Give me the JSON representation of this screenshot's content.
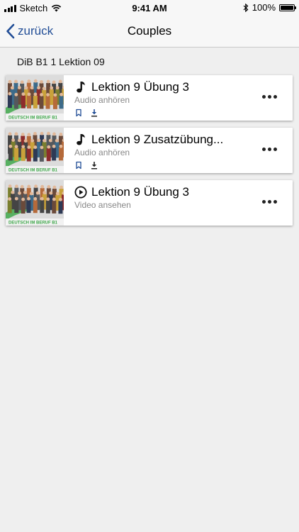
{
  "status_bar": {
    "carrier": "Sketch",
    "time": "9:41 AM",
    "battery": "100%",
    "battery_level": 1.0
  },
  "nav": {
    "back_label": "zurück",
    "title": "Couples"
  },
  "section": {
    "title": "DiB B1 1 Lektion 09"
  },
  "items": [
    {
      "title": "Lektion 9 Übung 3",
      "subtitle": "Audio anhören",
      "type_icon": "music-note-icon",
      "thumb_text": "DEUTSCH IM BERUF B1"
    },
    {
      "title": "Lektion 9 Zusatzübung...",
      "subtitle": "Audio anhören",
      "type_icon": "music-note-icon",
      "thumb_text": "DEUTSCH IM BERUF B1"
    },
    {
      "title": "Lektion 9 Übung 3",
      "subtitle": "Video ansehen",
      "type_icon": "play-circle-icon",
      "thumb_text": "DEUTSCH IM BERUF B1"
    }
  ],
  "colors": {
    "accent": "#214d96",
    "thumb_green": "#3fa84b"
  }
}
